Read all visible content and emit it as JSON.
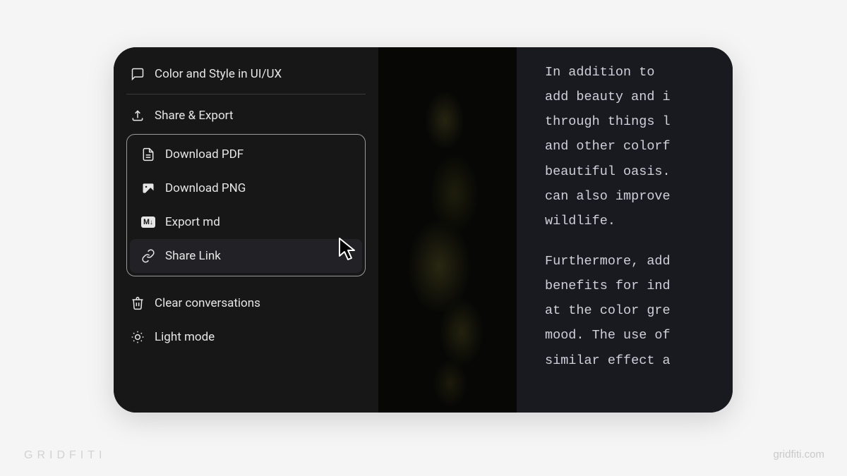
{
  "sidebar": {
    "conversation": "Color and Style in UI/UX",
    "share_export": "Share & Export",
    "export_menu": {
      "pdf": "Download PDF",
      "png": "Download PNG",
      "md": "Export md",
      "link": "Share Link"
    },
    "clear": "Clear conversations",
    "light_mode": "Light mode"
  },
  "content": {
    "p1_l1": "In addition to ",
    "p1_l2": "add beauty and i",
    "p1_l3": "through things l",
    "p1_l4": "and other colorf",
    "p1_l5": "beautiful oasis.",
    "p1_l6": "can also improve",
    "p1_l7": "wildlife.",
    "p2_l1": "Furthermore, add",
    "p2_l2": "benefits for ind",
    "p2_l3": "at the color gre",
    "p2_l4": "mood. The use of",
    "p2_l5": "similar effect a"
  },
  "brand": {
    "left": "GRIDFITI",
    "right": "gridfiti.com"
  }
}
